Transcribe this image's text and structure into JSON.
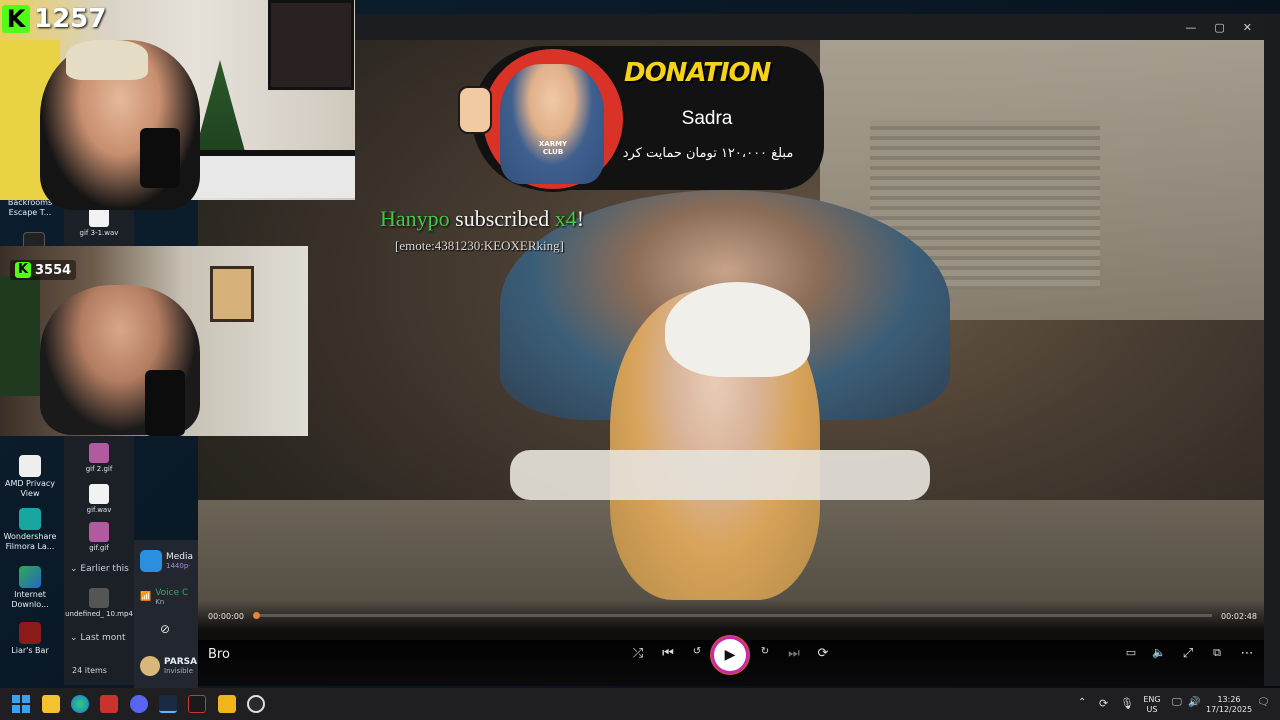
{
  "webcam_top": {
    "kick_count": "1257"
  },
  "webcam_bottom": {
    "kick_count": "3554"
  },
  "desktop_icons": [
    {
      "label": "Backrooms Escape T..."
    },
    {
      "label": "AMD Privacy View"
    },
    {
      "label": "Wondershare Filmora La..."
    },
    {
      "label": "Internet Downlo..."
    },
    {
      "label": "Liar's Bar"
    }
  ],
  "explorer": {
    "items": [
      {
        "label": "gif 3-1.wav"
      },
      {
        "label": "gif 2.gif"
      },
      {
        "label": "gif.wav"
      },
      {
        "label": "gif.gif"
      },
      {
        "label": "undefined_ 10.mp4"
      }
    ],
    "group_earlier": "Earlier this",
    "group_last": "Last mont",
    "item_count": "24 items"
  },
  "discord": {
    "media_title": "Media",
    "media_sub": "1440p·",
    "voice_title": "Voice C",
    "voice_sub": "Kn",
    "user_name": "PARSA",
    "user_status": "Invisible"
  },
  "player": {
    "track_name": "Bro",
    "time_current": "00:00:00",
    "time_total": "00:02:48",
    "progress": 0.0
  },
  "donation": {
    "title": "DONATION",
    "donor": "Sadra",
    "message": "مبلغ ۱۲۰،۰۰۰ تومان حمایت کرد",
    "mascot_shirt": "XARMY CLUB"
  },
  "subscription": {
    "user": "Hanypo",
    "text": "subscribed",
    "count": "x4",
    "bang": "!",
    "emote": "[emote:4381230:KEOXERking]"
  },
  "tray": {
    "lang_top": "ENG",
    "lang_bottom": "US",
    "time": "13:26",
    "date": "17/12/2025"
  },
  "colors": {
    "kick_green": "#53fc18",
    "donation_yellow": "#f6d21a",
    "sub_green": "#3fc94a",
    "seek_orange": "#e8833a"
  }
}
